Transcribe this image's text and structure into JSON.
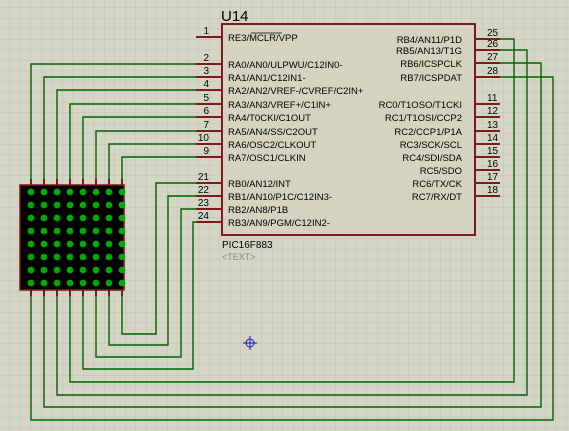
{
  "component": {
    "ref": "U14",
    "part": "PIC16F883",
    "text_placeholder": "<TEXT>",
    "left_pins": [
      {
        "num": "1",
        "name": "RE3/MCLR/VPP"
      },
      {
        "num": "2",
        "name": "RA0/AN0/ULPWU/C12IN0-"
      },
      {
        "num": "3",
        "name": "RA1/AN1/C12IN1-"
      },
      {
        "num": "4",
        "name": "RA2/AN2/VREF-/CVREF/C2IN+"
      },
      {
        "num": "5",
        "name": "RA3/AN3/VREF+/C1IN+"
      },
      {
        "num": "6",
        "name": "RA4/T0CKI/C1OUT"
      },
      {
        "num": "7",
        "name": "RA5/AN4/SS/C2OUT"
      },
      {
        "num": "10",
        "name": "RA6/OSC2/CLKOUT"
      },
      {
        "num": "9",
        "name": "RA7/OSC1/CLKIN"
      },
      {
        "num": "21",
        "name": "RB0/AN12/INT"
      },
      {
        "num": "22",
        "name": "RB1/AN10/P1C/C12IN3-"
      },
      {
        "num": "23",
        "name": "RB2/AN8/P1B"
      },
      {
        "num": "24",
        "name": "RB3/AN9/PGM/C12IN2-"
      }
    ],
    "right_pins": [
      {
        "num": "25",
        "name": "RB4/AN11/P1D"
      },
      {
        "num": "26",
        "name": "RB5/AN13/T1G"
      },
      {
        "num": "27",
        "name": "RB6/ICSPCLK"
      },
      {
        "num": "28",
        "name": "RB7/ICSPDAT"
      },
      {
        "num": "11",
        "name": "RC0/T1OSO/T1CKI"
      },
      {
        "num": "12",
        "name": "RC1/T1OSI/CCP2"
      },
      {
        "num": "13",
        "name": "RC2/CCP1/P1A"
      },
      {
        "num": "14",
        "name": "RC3/SCK/SCL"
      },
      {
        "num": "15",
        "name": "RC4/SDI/SDA"
      },
      {
        "num": "16",
        "name": "RC5/SDO"
      },
      {
        "num": "17",
        "name": "RC6/TX/CK"
      },
      {
        "num": "18",
        "name": "RC7/RX/DT"
      }
    ]
  },
  "matrix": {
    "rows": 8,
    "cols": 8
  },
  "colors": {
    "background": "#d5d5c5",
    "grid": "#c3c3b3",
    "body_fill": "#d3d3c0",
    "body_stroke": "#7d1a1a",
    "pin": "#7d1a1a",
    "wire": "#006400",
    "matrix_fill": "#000000",
    "led": "#00aa00",
    "marker": "#1a1acc"
  }
}
